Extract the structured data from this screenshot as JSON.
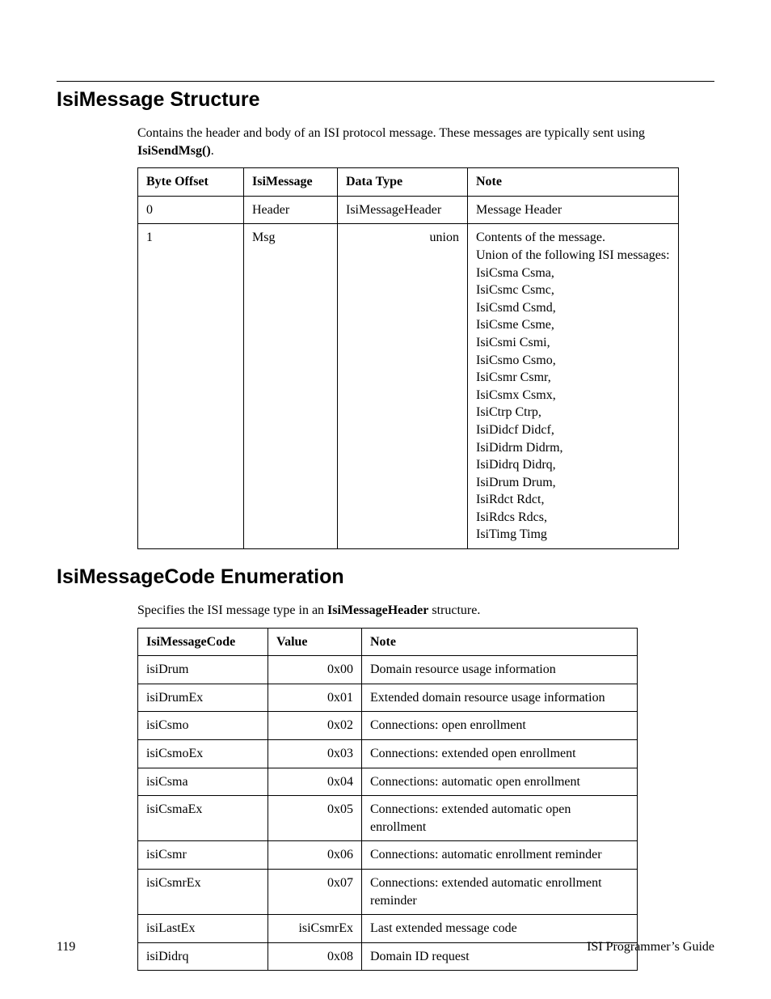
{
  "heading1": "IsiMessage Structure",
  "para1a": "Contains the header and body of an ISI protocol message.  These messages are typically sent using ",
  "para1b": "IsiSendMsg()",
  "para1c": ".",
  "table1": {
    "h1": "Byte Offset",
    "h2": "IsiMessage",
    "h3": "Data Type",
    "h4": "Note",
    "r1c1": "0",
    "r1c2": "Header",
    "r1c3": "IsiMessageHeader",
    "r1c4": "Message Header",
    "r2c1": "1",
    "r2c2": "Msg",
    "r2c3": "union",
    "r2n0": "Contents of the message.",
    "r2n1": "Union of the following ISI messages:",
    "r2n2": "IsiCsma Csma,",
    "r2n3": "IsiCsmc Csmc,",
    "r2n4": "IsiCsmd Csmd,",
    "r2n5": "IsiCsme Csme,",
    "r2n6": "IsiCsmi Csmi,",
    "r2n7": "IsiCsmo Csmo,",
    "r2n8": "IsiCsmr Csmr,",
    "r2n9": "IsiCsmx Csmx,",
    "r2n10": "IsiCtrp Ctrp,",
    "r2n11": "IsiDidcf Didcf,",
    "r2n12": "IsiDidrm Didrm,",
    "r2n13": "IsiDidrq Didrq,",
    "r2n14": "IsiDrum Drum,",
    "r2n15": "IsiRdct Rdct,",
    "r2n16": "IsiRdcs Rdcs,",
    "r2n17": "IsiTimg Timg"
  },
  "heading2": "IsiMessageCode Enumeration",
  "para2a": "Specifies the ISI message type in an ",
  "para2b": "IsiMessageHeader",
  "para2c": " structure.",
  "table2": {
    "h1": "IsiMessageCode",
    "h2": "Value",
    "h3": "Note",
    "rows": [
      {
        "c1": "isiDrum",
        "c2": "0x00",
        "c3": "Domain resource usage information"
      },
      {
        "c1": "isiDrumEx",
        "c2": "0x01",
        "c3": "Extended domain resource usage information"
      },
      {
        "c1": "isiCsmo",
        "c2": "0x02",
        "c3": "Connections: open enrollment"
      },
      {
        "c1": "isiCsmoEx",
        "c2": "0x03",
        "c3": "Connections: extended open enrollment"
      },
      {
        "c1": "isiCsma",
        "c2": "0x04",
        "c3": "Connections: automatic open enrollment"
      },
      {
        "c1": "isiCsmaEx",
        "c2": "0x05",
        "c3": "Connections: extended automatic open enrollment"
      },
      {
        "c1": "isiCsmr",
        "c2": "0x06",
        "c3": "Connections: automatic enrollment reminder"
      },
      {
        "c1": "isiCsmrEx",
        "c2": "0x07",
        "c3": "Connections: extended automatic enrollment reminder"
      },
      {
        "c1": "isiLastEx",
        "c2": "isiCsmrEx",
        "c3": "Last extended message code"
      },
      {
        "c1": "isiDidrq",
        "c2": "0x08",
        "c3": "Domain ID request"
      }
    ]
  },
  "footer": {
    "pagenum": "119",
    "title": "ISI Programmer’s Guide"
  }
}
